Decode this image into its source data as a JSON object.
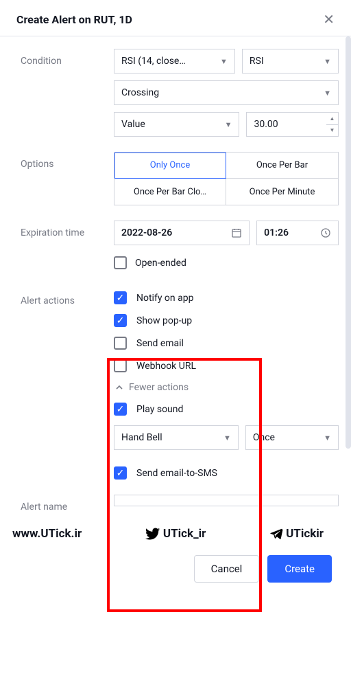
{
  "header": {
    "title": "Create Alert on RUT, 1D"
  },
  "labels": {
    "condition": "Condition",
    "options": "Options",
    "expiration": "Expiration time",
    "alert_actions": "Alert actions",
    "alert_name": "Alert name"
  },
  "condition": {
    "source": "RSI (14, close…",
    "plot": "RSI",
    "operator": "Crossing",
    "value_mode": "Value",
    "value_number": "30.00"
  },
  "options": {
    "items": [
      "Only Once",
      "Once Per Bar",
      "Once Per Bar Clo…",
      "Once Per Minute"
    ],
    "active": "Only Once"
  },
  "expiration": {
    "date": "2022-08-26",
    "time": "01:26",
    "open_ended_label": "Open-ended",
    "open_ended_checked": false
  },
  "actions": {
    "items": [
      {
        "label": "Notify on app",
        "checked": true
      },
      {
        "label": "Show pop-up",
        "checked": true
      },
      {
        "label": "Send email",
        "checked": false
      },
      {
        "label": "Webhook URL",
        "checked": false
      }
    ],
    "fewer_label": "Fewer actions",
    "play_sound": {
      "label": "Play sound",
      "checked": true
    },
    "sound_name": "Hand Bell",
    "sound_repeat": "Once",
    "email_sms": {
      "label": "Send email-to-SMS",
      "checked": true
    }
  },
  "alert_name_value": "",
  "social": {
    "site": "www.UTick.ir",
    "twitter": "UTick_ir",
    "telegram": "UTickir"
  },
  "footer": {
    "cancel": "Cancel",
    "create": "Create"
  }
}
